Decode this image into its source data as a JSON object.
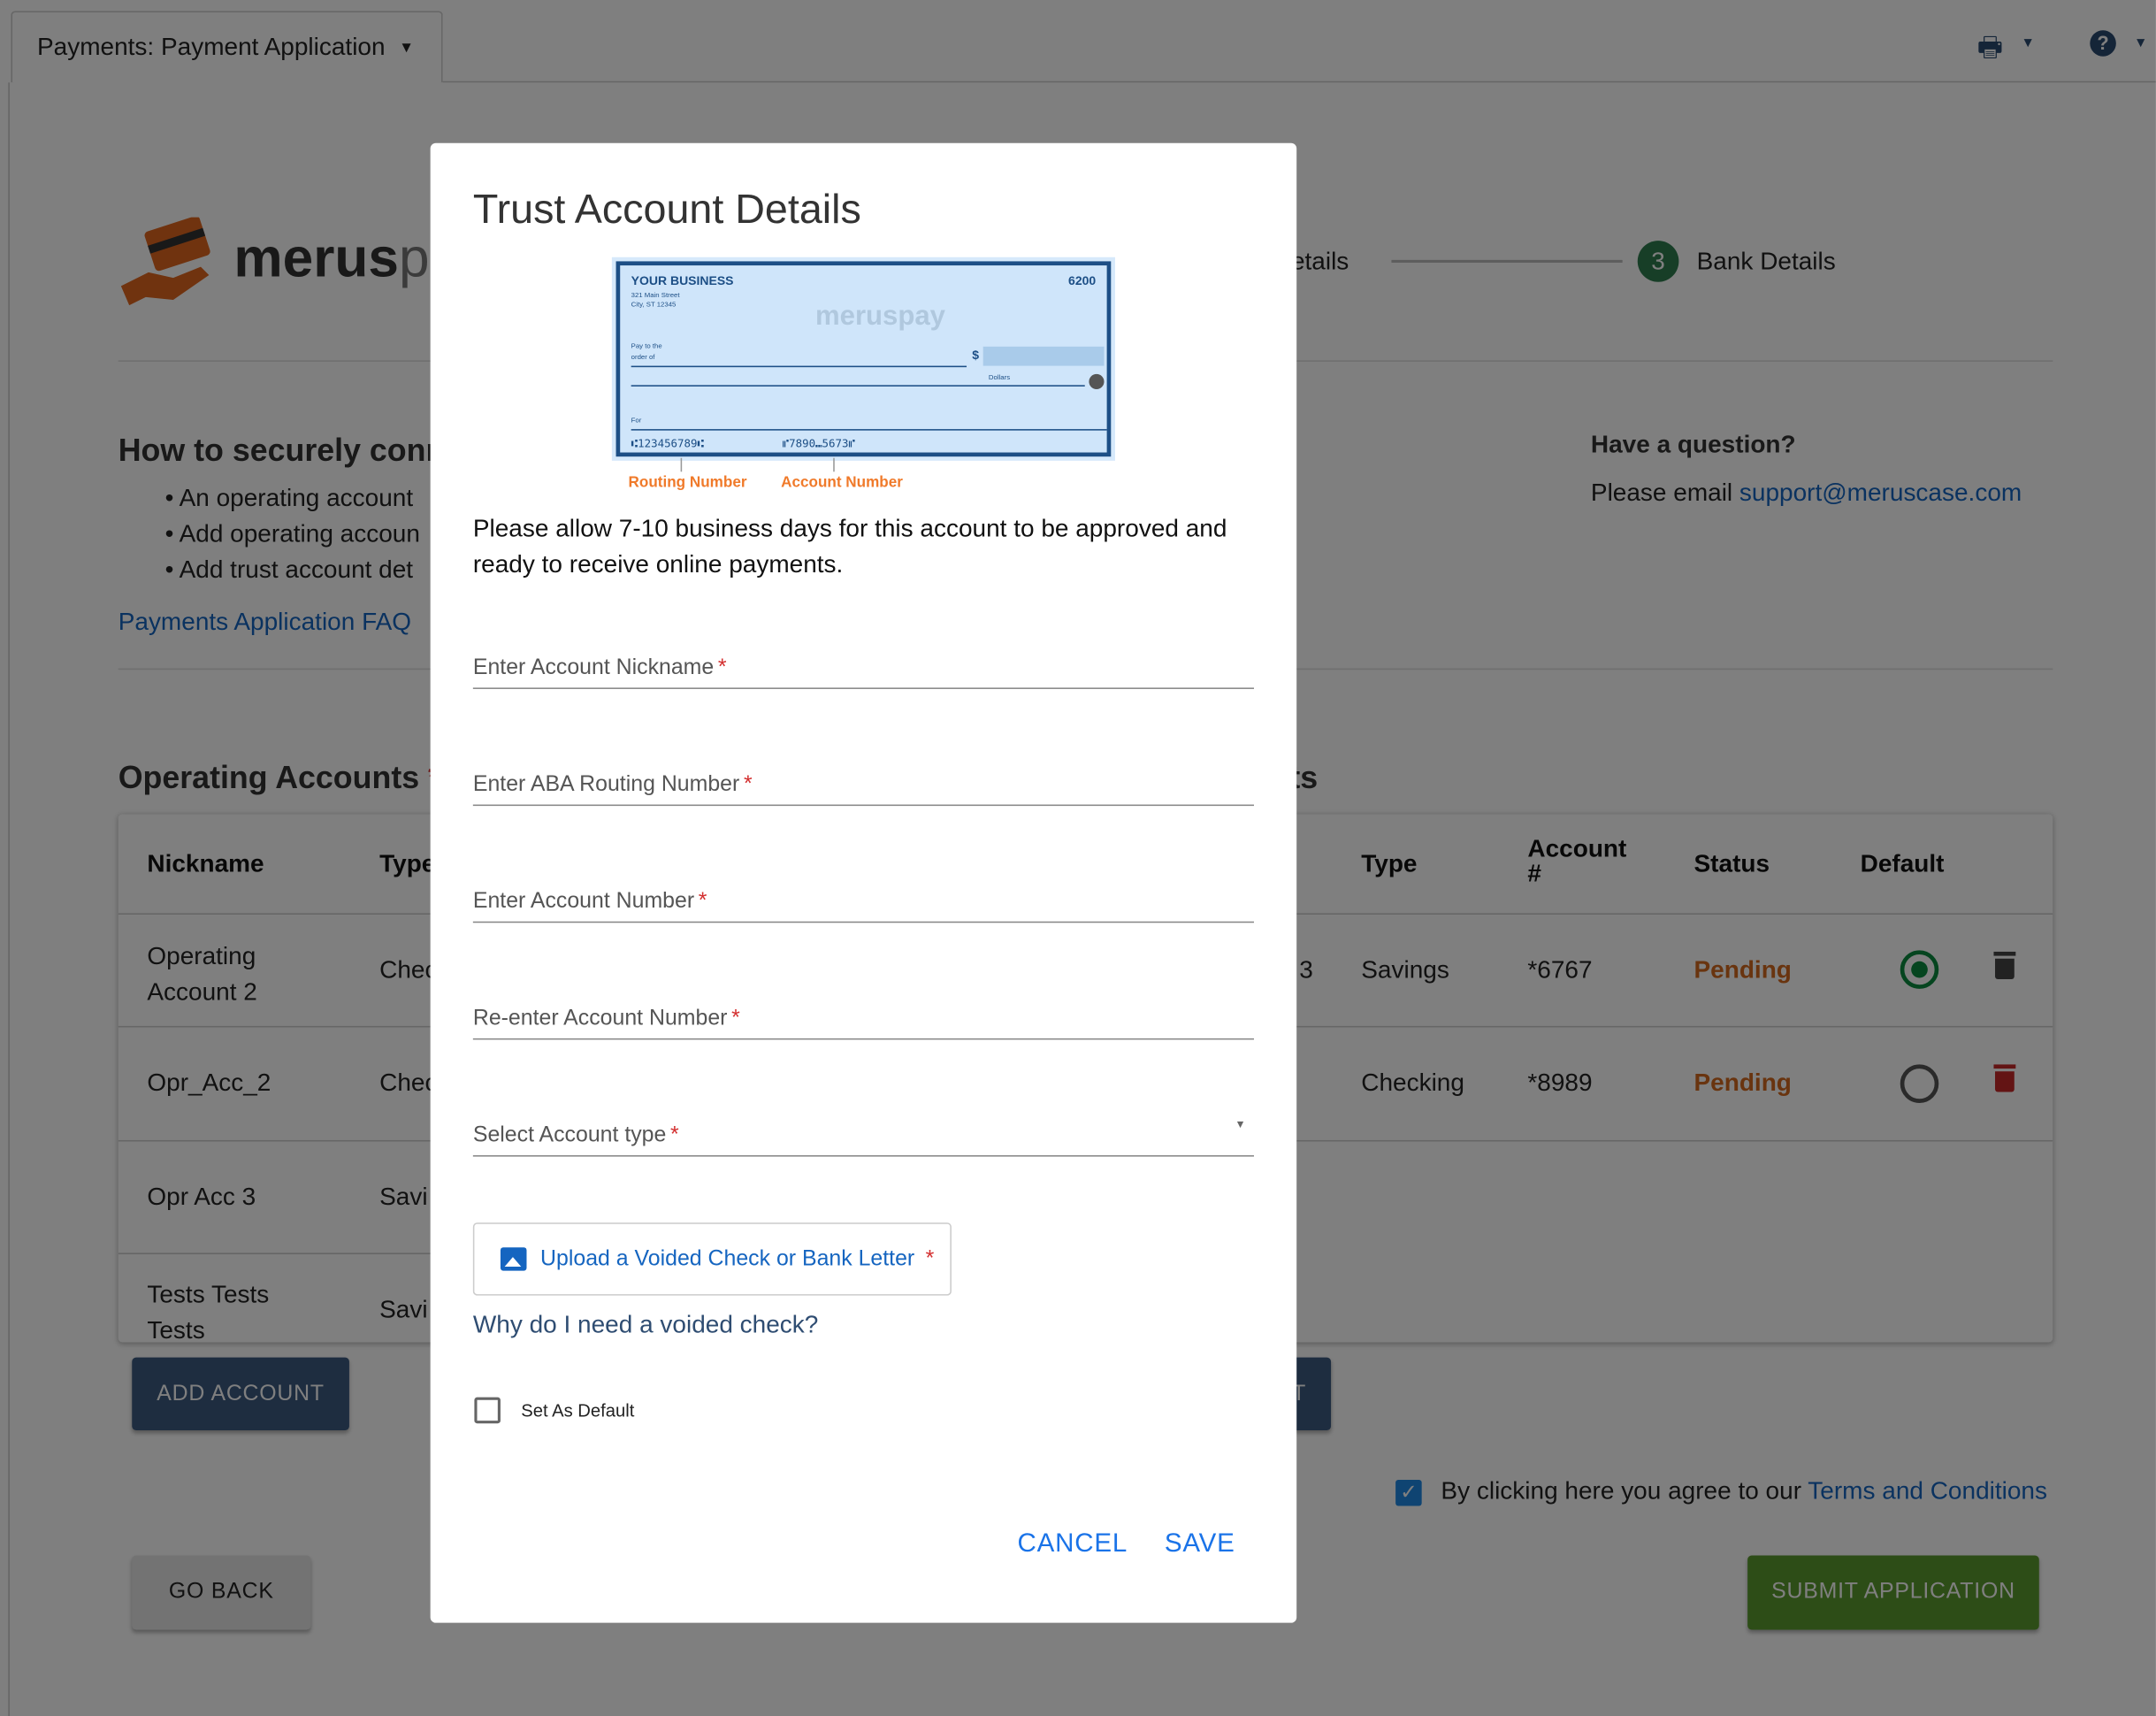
{
  "header": {
    "tab_title": "Payments: Payment Application",
    "print_icon": "print-icon",
    "help_icon": "help-icon"
  },
  "brand": {
    "logo_text_bold": "merus",
    "logo_text_light": "pay"
  },
  "stepper": {
    "step2_label": "Details",
    "step3_number": "3",
    "step3_label": "Bank Details",
    "active_color": "#2e7d4f"
  },
  "intro": {
    "heading": "How to securely conn",
    "bullets": [
      "An operating account",
      "Add operating accoun",
      "Add trust account det"
    ],
    "faq_link": "Payments Application FAQ"
  },
  "help": {
    "heading": "Have a question?",
    "text": "Please email ",
    "email": "support@meruscase.com"
  },
  "operating": {
    "title": "Operating Accounts",
    "required": "*",
    "headers": [
      "Nickname",
      "Type"
    ],
    "rows": [
      {
        "nickname": "Operating Account 2",
        "type": "Chec"
      },
      {
        "nickname": "Opr_Acc_2",
        "type": "Chec"
      },
      {
        "nickname": "Opr Acc 3",
        "type": "Savi"
      },
      {
        "nickname": "Tests Tests Tests",
        "type": "Savi"
      }
    ],
    "add_button": "ADD ACCOUNT"
  },
  "trust": {
    "title": "ts",
    "headers": [
      "Type",
      "Account #",
      "Status",
      "Default"
    ],
    "rows": [
      {
        "nickname": "3",
        "type": "Savings",
        "account": "*6767",
        "status": "Pending",
        "default": true,
        "delete_color": "#444444"
      },
      {
        "nickname": "",
        "type": "Checking",
        "account": "*8989",
        "status": "Pending",
        "default": false,
        "delete_color": "#c62828"
      }
    ],
    "add_button": "T"
  },
  "terms": {
    "checked": true,
    "text": "By clicking here you agree to our ",
    "link": "Terms and Conditions"
  },
  "footer": {
    "back": "GO BACK",
    "submit": "SUBMIT APPLICATION"
  },
  "modal": {
    "title": "Trust Account Details",
    "check": {
      "business": "YOUR BUSINESS",
      "address1": "321 Main Street",
      "address2": "City, ST 12345",
      "number": "6200",
      "pay_to": "Pay to the",
      "order_of": "order of",
      "dollars": "Dollars",
      "for": "For",
      "routing_digits": "⑆123456789⑆",
      "account_digits": "⑈7890⑉5673⑈",
      "watermark": "meruspay",
      "routing_label": "Routing Number",
      "account_label": "Account Number"
    },
    "notice": "Please allow 7-10 business days for this account to be approved and ready to receive online payments.",
    "fields": [
      {
        "label": "Enter Account Nickname",
        "value": ""
      },
      {
        "label": "Enter ABA Routing Number",
        "value": ""
      },
      {
        "label": "Enter Account Number",
        "value": ""
      },
      {
        "label": "Re-enter Account Number",
        "value": ""
      },
      {
        "label": "Select Account type",
        "value": ""
      }
    ],
    "required_mark": "*",
    "upload_label": "Upload a Voided Check or Bank Letter",
    "why_link": "Why do I need a voided check?",
    "default_label": "Set As Default",
    "default_checked": false,
    "cancel": "CANCEL",
    "save": "SAVE"
  }
}
